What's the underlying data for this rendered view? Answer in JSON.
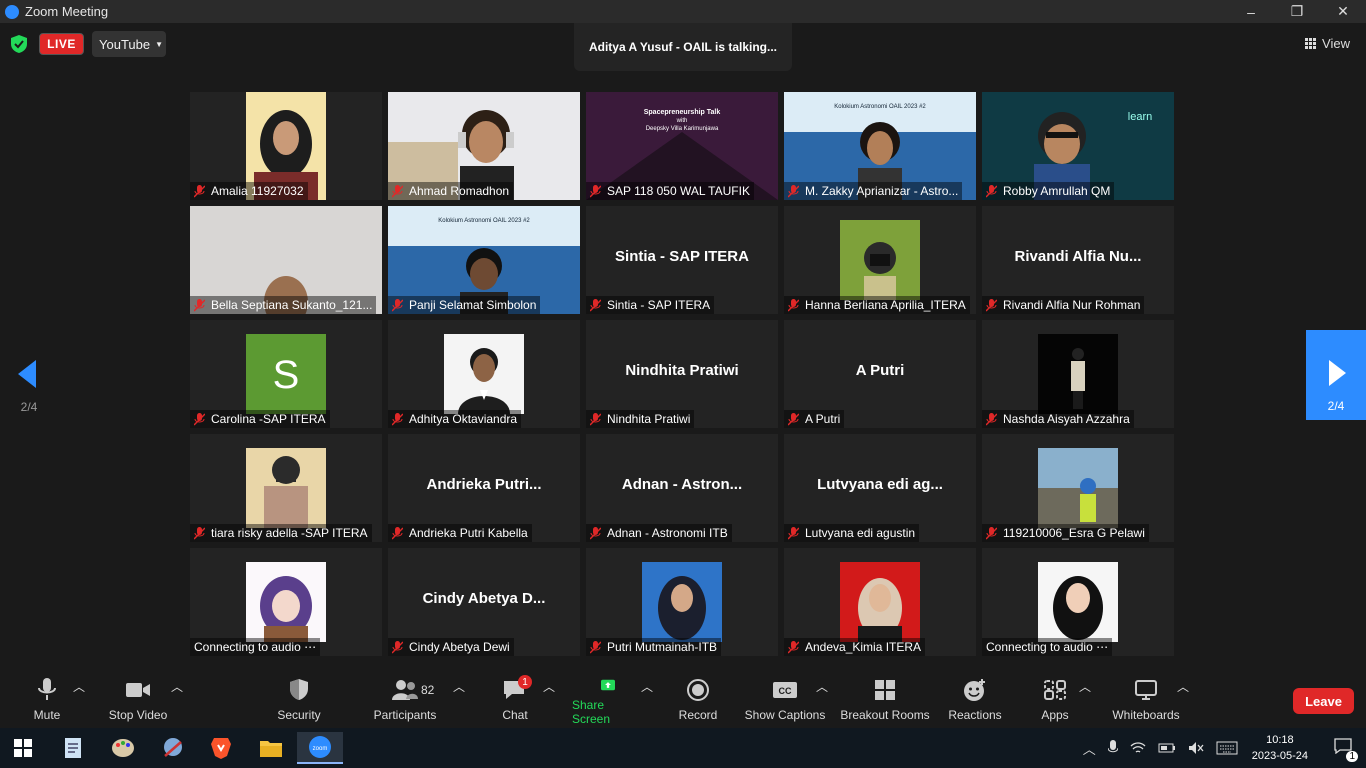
{
  "window": {
    "title": "Zoom Meeting",
    "controls": [
      "–",
      "❐",
      "✕"
    ]
  },
  "topbar": {
    "live_label": "LIVE",
    "stream_target": "YouTube",
    "talking_banner": "Aditya A Yusuf - OAIL is talking...",
    "view_label": "View"
  },
  "pager": {
    "left_page": "2/4",
    "right_page": "2/4"
  },
  "tiles": [
    {
      "name": "Amalia 11927032",
      "big": "",
      "video": "person-hijab-black"
    },
    {
      "name": "Ahmad Romadhon",
      "big": "",
      "video": "person-headphones"
    },
    {
      "name": "SAP 118 050 WAL TAUFIK",
      "big": "",
      "video": "slide-spacepreneurship"
    },
    {
      "name": "M. Zakky Aprianizar - Astro...",
      "big": "",
      "video": "person-virtual-bg-blue"
    },
    {
      "name": "Robby Amrullah QM",
      "big": "",
      "video": "person-virtual-bg-teal"
    },
    {
      "name": "Bella Septiana Sukanto_121...",
      "big": "",
      "video": "person-wall"
    },
    {
      "name": "Panji Selamat Simbolon",
      "big": "",
      "video": "person-virtual-bg-blue2"
    },
    {
      "name": "Sintia - SAP ITERA",
      "big": "Sintia - SAP ITERA",
      "video": ""
    },
    {
      "name": "Hanna Berliana Aprilia_ITERA",
      "big": "",
      "video": "profile-camera-green"
    },
    {
      "name": "Rivandi Alfia Nur Rohman",
      "big": "Rivandi Alfia Nu...",
      "video": ""
    },
    {
      "name": "Carolina -SAP ITERA",
      "big": "",
      "video": "avatar-letter-s",
      "letter": "S"
    },
    {
      "name": "Adhitya Oktaviandra",
      "big": "",
      "video": "profile-formal-white"
    },
    {
      "name": "Nindhita Pratiwi",
      "big": "Nindhita Pratiwi",
      "video": ""
    },
    {
      "name": "A Putri",
      "big": "A Putri",
      "video": ""
    },
    {
      "name": "Nashda Aisyah Azzahra",
      "big": "",
      "video": "profile-dark-standing"
    },
    {
      "name": "tiara risky adella -SAP ITERA",
      "big": "",
      "video": "profile-masked"
    },
    {
      "name": "Andrieka Putri Kabella",
      "big": "Andrieka  Putri...",
      "video": ""
    },
    {
      "name": "Adnan - Astronomi ITB",
      "big": "Adnan - Astron...",
      "video": ""
    },
    {
      "name": "Lutvyana edi agustin",
      "big": "Lutvyana edi ag...",
      "video": ""
    },
    {
      "name": "119210006_Esra G Pelawi",
      "big": "",
      "video": "profile-helmet-outdoor"
    },
    {
      "name": "Connecting to audio ⋯",
      "big": "",
      "video": "profile-anime",
      "connecting": true
    },
    {
      "name": "Cindy Abetya Dewi",
      "big": "Cindy Abetya D...",
      "video": ""
    },
    {
      "name": "Putri Mutmainah-ITB",
      "big": "",
      "video": "profile-hijab-blue"
    },
    {
      "name": "Andeva_Kimia ITERA",
      "big": "",
      "video": "profile-hijab-red"
    },
    {
      "name": "Connecting to audio ⋯",
      "big": "",
      "video": "profile-hijab-black",
      "connecting": true
    }
  ],
  "toolbar": {
    "mute": "Mute",
    "stop_video": "Stop Video",
    "security": "Security",
    "participants": "Participants",
    "participants_count": "82",
    "chat": "Chat",
    "chat_badge": "1",
    "share_screen": "Share Screen",
    "record": "Record",
    "show_captions": "Show Captions",
    "breakout_rooms": "Breakout Rooms",
    "reactions": "Reactions",
    "apps": "Apps",
    "whiteboards": "Whiteboards",
    "leave": "Leave"
  },
  "taskbar": {
    "time": "10:18",
    "date": "2023-05-24",
    "notification_count": "1",
    "apps": [
      "start-icon",
      "notepad-icon",
      "paint-icon",
      "snipping-icon",
      "brave-icon",
      "file-explorer-icon",
      "zoom-icon"
    ]
  },
  "colors": {
    "accent": "#2d8cff",
    "live": "#e02828",
    "leave": "#e02828",
    "share": "#23d959"
  }
}
